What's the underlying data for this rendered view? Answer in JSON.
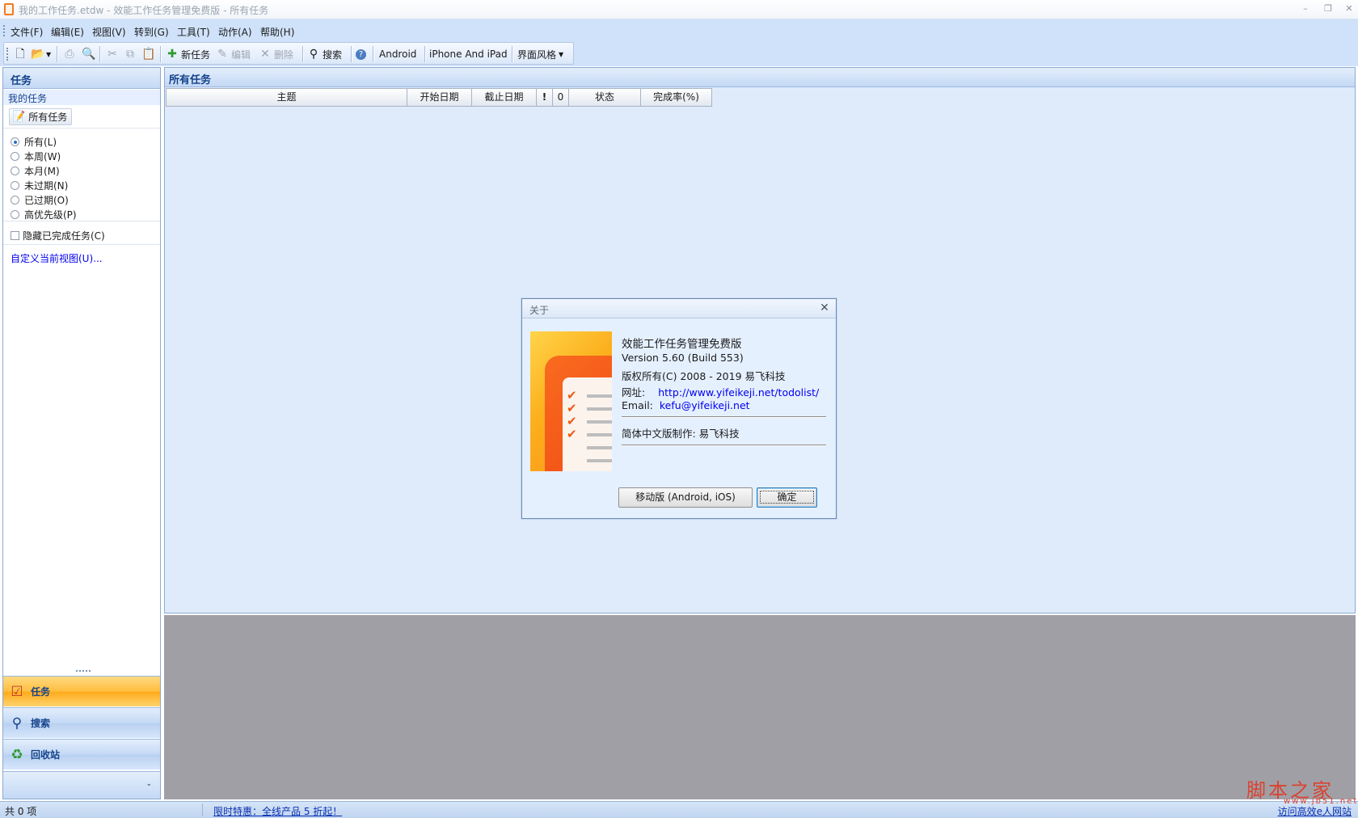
{
  "window": {
    "title": "我的工作任务.etdw - 效能工作任务管理免费版 - 所有任务",
    "minimize_glyph": "–",
    "maximize_glyph": "❐",
    "close_glyph": "✕"
  },
  "menu": {
    "items": [
      "文件(F)",
      "编辑(E)",
      "视图(V)",
      "转到(G)",
      "工具(T)",
      "动作(A)",
      "帮助(H)"
    ]
  },
  "toolbar": {
    "new_task": "新任务",
    "edit": "编辑",
    "delete": "删除",
    "search": "搜索",
    "android": "Android",
    "iphone_ipad": "iPhone And iPad",
    "skin": "界面风格",
    "icons": [
      "new-document-icon",
      "open-folder-icon",
      "print-icon",
      "print-preview-icon",
      "cut-icon",
      "copy-icon",
      "paste-icon",
      "add-icon",
      "edit-icon",
      "delete-icon",
      "search-icon",
      "help-icon"
    ]
  },
  "left_pane": {
    "header": "任务",
    "section_label": "我的任务",
    "all_tasks_button": "所有任务",
    "filters": [
      {
        "label": "所有(L)",
        "selected": true
      },
      {
        "label": "本周(W)",
        "selected": false
      },
      {
        "label": "本月(M)",
        "selected": false
      },
      {
        "label": "未过期(N)",
        "selected": false
      },
      {
        "label": "已过期(O)",
        "selected": false
      },
      {
        "label": "高优先级(P)",
        "selected": false
      }
    ],
    "hide_completed": {
      "label": "隐藏已完成任务(C)",
      "checked": false
    },
    "customize_view": "自定义当前视图(U)...",
    "nav": [
      {
        "label": "任务",
        "active": true,
        "icon": "task-list-icon"
      },
      {
        "label": "搜索",
        "active": false,
        "icon": "magnifier-icon"
      },
      {
        "label": "回收站",
        "active": false,
        "icon": "recycle-bin-icon"
      }
    ],
    "nav_chevron": "⌄"
  },
  "main": {
    "header": "所有任务",
    "columns": [
      "主题",
      "开始日期",
      "截止日期",
      "!",
      "0",
      "状态",
      "完成率(%)"
    ]
  },
  "statusbar": {
    "count": "共 0 项",
    "promo": "限时特惠：全线产品 5 折起！",
    "visit": "访问高效e人网站"
  },
  "watermark": {
    "text": "脚本之家",
    "sub": "www.jb51.net"
  },
  "about_dialog": {
    "title": "关于",
    "close_glyph": "✕",
    "product": "效能工作任务管理免费版",
    "version": "Version 5.60 (Build 553)",
    "copyright": "版权所有(C) 2008 - 2019 易飞科技",
    "website_label": "网址:",
    "website_url": "http://www.yifeikeji.net/todolist/",
    "email_label": "Email:",
    "email": "kefu@yifeikeji.net",
    "localization": "简体中文版制作:  易飞科技",
    "mobile_button": "移动版 (Android, iOS)",
    "ok_button": "确定"
  },
  "colors": {
    "accent": "#15428b",
    "ribbon_bg": "#cfe2fa",
    "main_bg": "#dfebfb",
    "preview_bg": "#a19fa6",
    "active_nav": "#ffbe3e",
    "link": "#0000ee",
    "watermark": "#d9432f"
  }
}
